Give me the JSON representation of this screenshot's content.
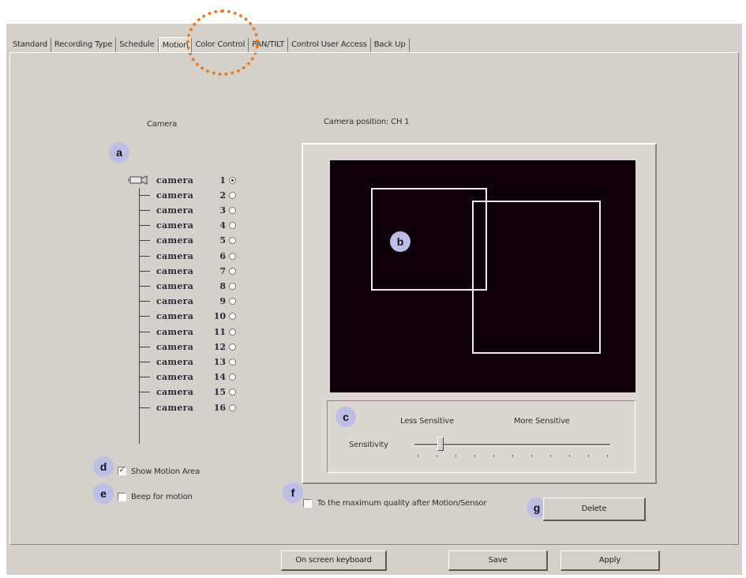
{
  "tabs": [
    "Standard",
    "Recording Type",
    "Schedule",
    "Motion",
    "Color Control",
    "PAN/TILT",
    "Control User Access",
    "Back Up"
  ],
  "active_tab": "Motion",
  "camera_header": "Camera",
  "camera_position_label": "Camera position: CH 1",
  "cameras": [
    {
      "name": "camera",
      "num": "1",
      "selected": true
    },
    {
      "name": "camera",
      "num": "2",
      "selected": false
    },
    {
      "name": "camera",
      "num": "3",
      "selected": false
    },
    {
      "name": "camera",
      "num": "4",
      "selected": false
    },
    {
      "name": "camera",
      "num": "5",
      "selected": false
    },
    {
      "name": "camera",
      "num": "6",
      "selected": false
    },
    {
      "name": "camera",
      "num": "7",
      "selected": false
    },
    {
      "name": "camera",
      "num": "8",
      "selected": false
    },
    {
      "name": "camera",
      "num": "9",
      "selected": false
    },
    {
      "name": "camera",
      "num": "10",
      "selected": false
    },
    {
      "name": "camera",
      "num": "11",
      "selected": false
    },
    {
      "name": "camera",
      "num": "12",
      "selected": false
    },
    {
      "name": "camera",
      "num": "13",
      "selected": false
    },
    {
      "name": "camera",
      "num": "14",
      "selected": false
    },
    {
      "name": "camera",
      "num": "15",
      "selected": false
    },
    {
      "name": "camera",
      "num": "16",
      "selected": false
    }
  ],
  "sensitivity": {
    "less": "Less Sensitive",
    "more": "More Sensitive",
    "label": "Sensitivity",
    "level": 0.12
  },
  "options": {
    "show_motion_area": "Show Motion Area",
    "show_motion_area_checked": true,
    "beep_for_motion": "Beep for motion",
    "beep_for_motion_checked": false,
    "max_quality": "To the maximum quality after Motion/Sensor",
    "max_quality_checked": false
  },
  "buttons": {
    "delete": "Delete",
    "on_screen_keyboard": "On screen keyboard",
    "save": "Save",
    "apply": "Apply"
  },
  "badges": {
    "a": "a",
    "b": "b",
    "c": "c",
    "d": "d",
    "e": "e",
    "f": "f",
    "g": "g"
  },
  "colors": {
    "highlight_circle": "#ec7a1e",
    "badge": "#bcbee6",
    "screen": "#0d0008"
  }
}
